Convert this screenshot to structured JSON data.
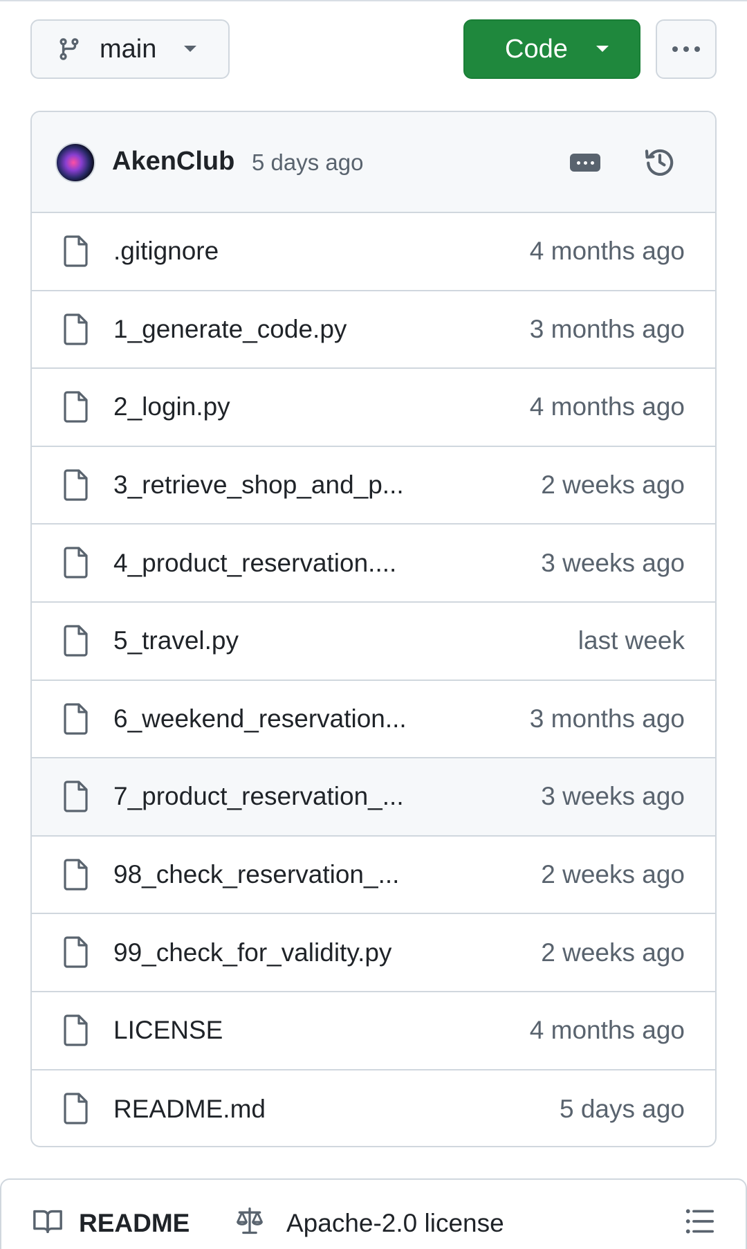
{
  "toolbar": {
    "branch_icon": "git-branch-icon",
    "branch_label": "main",
    "code_label": "Code",
    "more_icon": "kebab-horizontal-icon"
  },
  "colors": {
    "code_button": "#1f883d",
    "muted_text": "#59636e",
    "border": "#d0d7de",
    "panel_bg": "#f6f8fa"
  },
  "commit": {
    "author": "AkenClub",
    "time": "5 days ago",
    "history_icon": "history-icon",
    "details_icon": "ellipsis-icon"
  },
  "files": [
    {
      "name": ".gitignore",
      "age": "4 months ago"
    },
    {
      "name": "1_generate_code.py",
      "age": "3 months ago"
    },
    {
      "name": "2_login.py",
      "age": "4 months ago"
    },
    {
      "name": "3_retrieve_shop_and_p...",
      "age": "2 weeks ago"
    },
    {
      "name": "4_product_reservation....",
      "age": "3 weeks ago"
    },
    {
      "name": "5_travel.py",
      "age": "last week"
    },
    {
      "name": "6_weekend_reservation...",
      "age": "3 months ago"
    },
    {
      "name": "7_product_reservation_...",
      "age": "3 weeks ago"
    },
    {
      "name": "98_check_reservation_...",
      "age": "2 weeks ago"
    },
    {
      "name": "99_check_for_validity.py",
      "age": "2 weeks ago"
    },
    {
      "name": "LICENSE",
      "age": "4 months ago"
    },
    {
      "name": "README.md",
      "age": "5 days ago"
    }
  ],
  "readme_tabs": {
    "readme_label": "README",
    "license_label": "Apache-2.0 license"
  }
}
